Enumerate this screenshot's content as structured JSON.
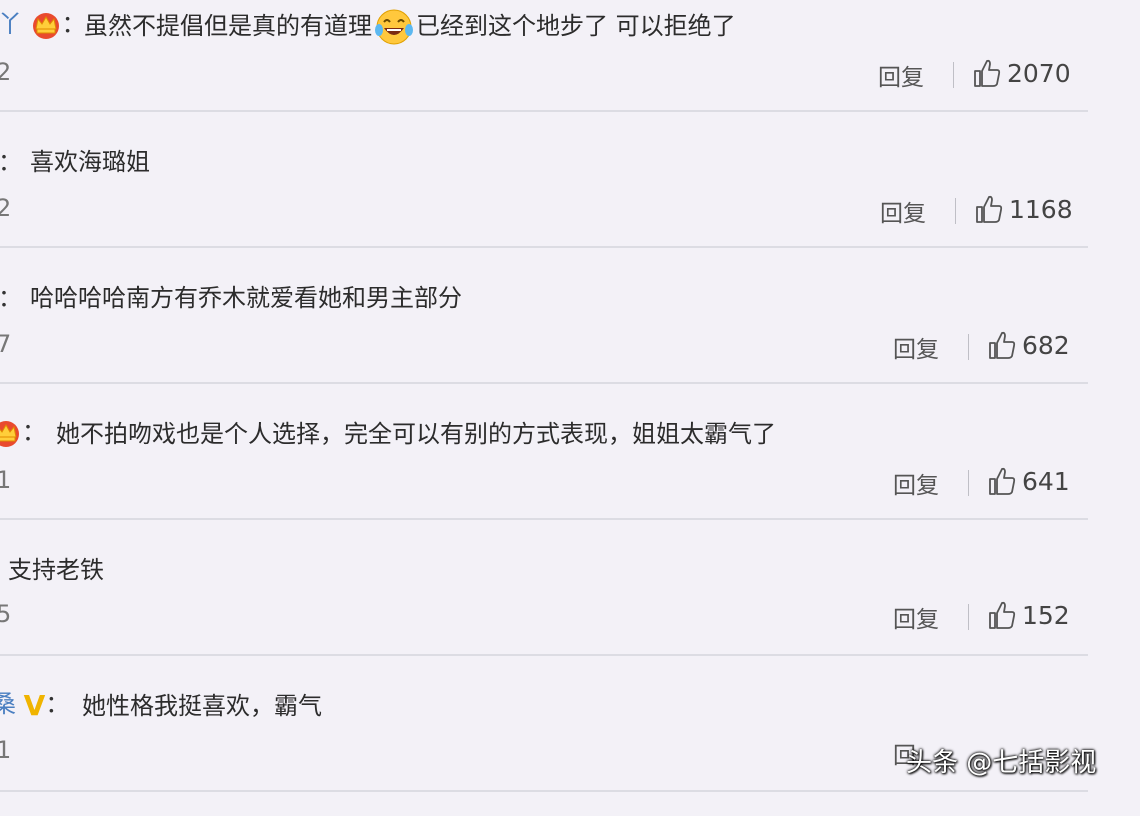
{
  "comments": [
    {
      "prefix": "丫",
      "badge": "crown-icon",
      "text_a": "虽然不提倡但是真的有道理",
      "emoji": "laughing-tears-icon",
      "text_b": "已经到这个地步了 可以拒绝了",
      "date": "2",
      "reply": "回复",
      "likes": "2070"
    },
    {
      "prefix": "：",
      "text": "喜欢海璐姐",
      "date": "2",
      "reply": "回复",
      "likes": "1168"
    },
    {
      "prefix": "：",
      "text": "哈哈哈哈南方有乔木就爱看她和男主部分",
      "date": "7",
      "reply": "回复",
      "likes": "682"
    },
    {
      "badge": "crown-icon",
      "text": "她不拍吻戏也是个人选择，完全可以有别的方式表现，姐姐太霸气了",
      "date": "1",
      "reply": "回复",
      "likes": "641"
    },
    {
      "text": "支持老铁",
      "date": "5",
      "reply": "回复",
      "likes": "152"
    },
    {
      "prefix": "桑",
      "badge_text": "V",
      "text": "她性格我挺喜欢，霸气",
      "date": "1",
      "reply": "回"
    }
  ],
  "watermark": "头条 @七括影视",
  "colors": {
    "background": "#f3f1f7",
    "separator": "#dcdce3",
    "username": "#4a7fc1",
    "vip": "#f0b400"
  }
}
